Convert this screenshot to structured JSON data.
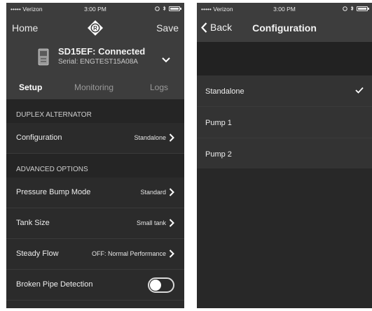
{
  "left_screen": {
    "status": {
      "carrier": "••••• Verizon",
      "time": "3:00 PM"
    },
    "nav": {
      "left": "Home",
      "right": "Save",
      "logo_icon": "brand-logo-icon"
    },
    "device": {
      "name": "SD15EF: Connected",
      "serial": "Serial: ENGTEST15A08A"
    },
    "tabs": [
      {
        "label": "Setup",
        "active": true
      },
      {
        "label": "Monitoring",
        "active": false
      },
      {
        "label": "Logs",
        "active": false
      }
    ],
    "section_duplex": {
      "title": "DUPLEX ALTERNATOR"
    },
    "configuration_row": {
      "label": "Configuration",
      "value": "Standalone"
    },
    "section_advanced": {
      "title": "ADVANCED OPTIONS"
    },
    "advanced_rows": [
      {
        "label": "Pressure Bump Mode",
        "value": "Standard"
      },
      {
        "label": "Tank Size",
        "value": "Small tank"
      },
      {
        "label": "Steady Flow",
        "value": "OFF: Normal Performance"
      }
    ],
    "broken_pipe": {
      "label": "Broken Pipe Detection",
      "enabled": false
    }
  },
  "right_screen": {
    "status": {
      "carrier": "••••• Verizon",
      "time": "3:00 PM"
    },
    "nav": {
      "back": "Back",
      "title": "Configuration"
    },
    "options": [
      {
        "label": "Standalone",
        "selected": true
      },
      {
        "label": "Pump 1",
        "selected": false
      },
      {
        "label": "Pump 2",
        "selected": false
      }
    ]
  },
  "colors": {
    "background": "#2b2b2b",
    "bar": "#3d3d3d",
    "section": "#252525",
    "text": "#ffffff"
  }
}
